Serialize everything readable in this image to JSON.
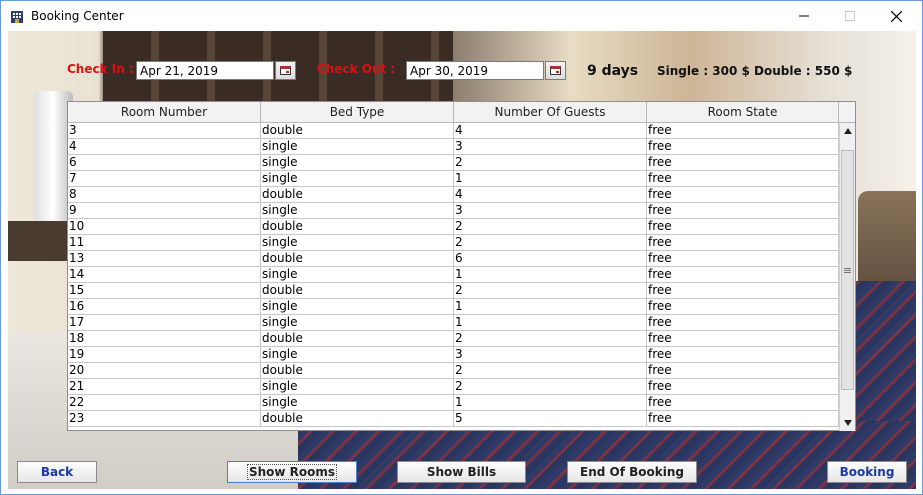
{
  "window": {
    "title": "Booking Center",
    "app_icon": "building-icon",
    "controls": {
      "minimize": "minimize-icon",
      "maximize": "maximize-icon",
      "close": "close-icon"
    }
  },
  "booking": {
    "check_in_label": "Check In :",
    "check_in_value": "Apr 21, 2019",
    "check_out_label": "Check Out :",
    "check_out_value": "Apr 30, 2019",
    "days": "9 days",
    "single_price": "Single : 300 $",
    "double_price": "Double : 550 $",
    "calendar_icon": "calendar-icon"
  },
  "table": {
    "columns": [
      "Room Number",
      "Bed Type",
      "Number Of Guests",
      "Room State"
    ],
    "rows": [
      [
        "3",
        "double",
        "4",
        "free"
      ],
      [
        "4",
        "single",
        "3",
        "free"
      ],
      [
        "6",
        "single",
        "2",
        "free"
      ],
      [
        "7",
        "single",
        "1",
        "free"
      ],
      [
        "8",
        "double",
        "4",
        "free"
      ],
      [
        "9",
        "single",
        "3",
        "free"
      ],
      [
        "10",
        "double",
        "2",
        "free"
      ],
      [
        "11",
        "single",
        "2",
        "free"
      ],
      [
        "13",
        "double",
        "6",
        "free"
      ],
      [
        "14",
        "single",
        "1",
        "free"
      ],
      [
        "15",
        "double",
        "2",
        "free"
      ],
      [
        "16",
        "single",
        "1",
        "free"
      ],
      [
        "17",
        "single",
        "1",
        "free"
      ],
      [
        "18",
        "double",
        "2",
        "free"
      ],
      [
        "19",
        "single",
        "3",
        "free"
      ],
      [
        "20",
        "double",
        "2",
        "free"
      ],
      [
        "21",
        "single",
        "2",
        "free"
      ],
      [
        "22",
        "single",
        "1",
        "free"
      ],
      [
        "23",
        "double",
        "5",
        "free"
      ]
    ]
  },
  "buttons": {
    "back": "Back",
    "show_rooms": "Show Rooms",
    "show_bills": "Show Bills",
    "end_of_booking": "End Of Booking",
    "booking": "Booking"
  },
  "colors": {
    "label_red": "#e01010",
    "button_blue_text": "#1a3aa8"
  }
}
